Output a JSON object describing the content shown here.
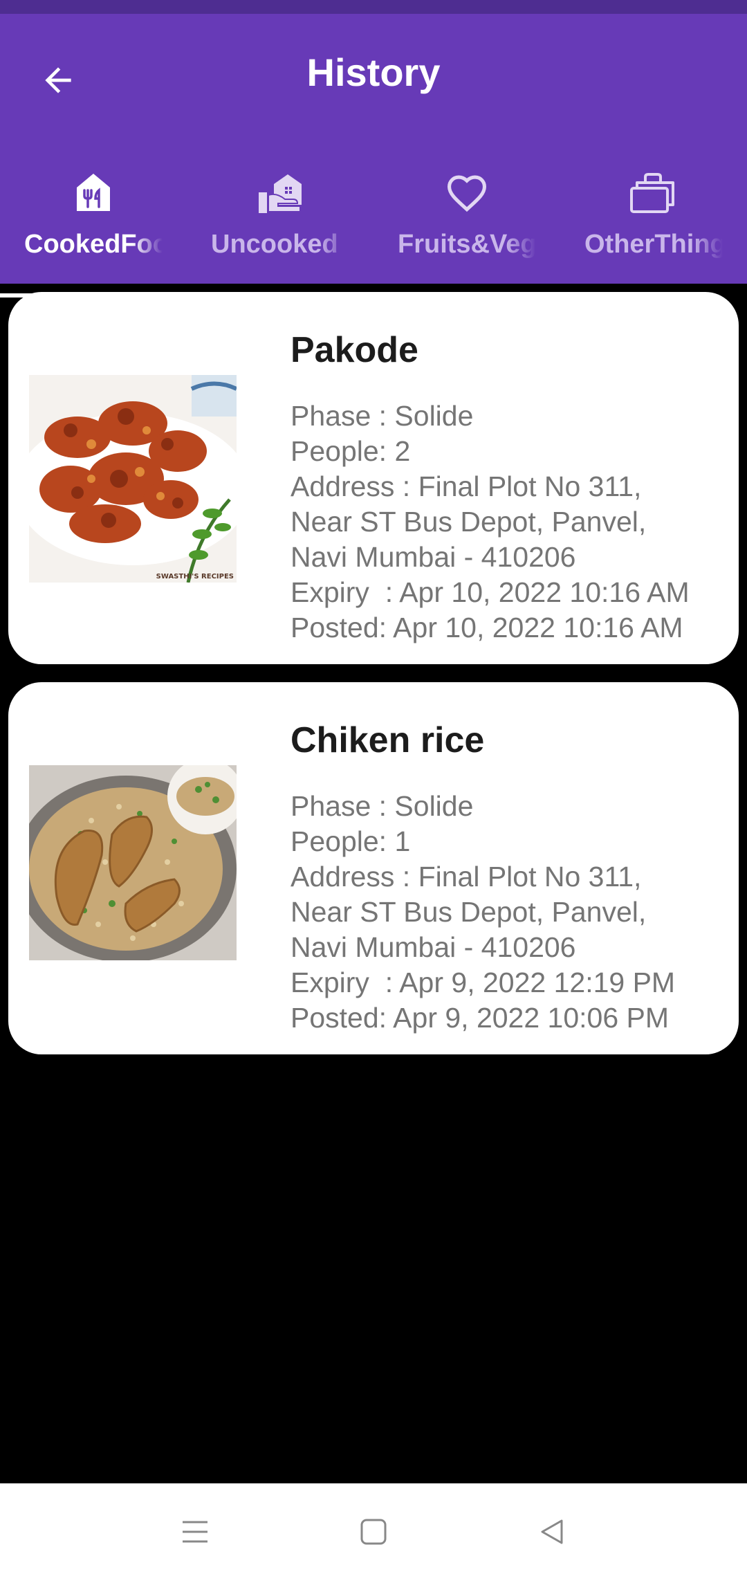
{
  "header": {
    "title": "History"
  },
  "tabs": [
    {
      "label": "CookedFood",
      "icon": "cooked-food-icon",
      "active": true
    },
    {
      "label": "Uncooked",
      "icon": "uncooked-food-icon",
      "active": false
    },
    {
      "label": "Fruits&Vegetables",
      "icon": "heart-icon",
      "active": false
    },
    {
      "label": "OtherThings",
      "icon": "other-things-icon",
      "active": false
    }
  ],
  "items": [
    {
      "name": "Pakode",
      "phase": "Phase : Solide",
      "people": "People: 2",
      "address": "Address : Final Plot No 311,\nNear ST Bus Depot, Panvel,\nNavi Mumbai - 410206",
      "expiry": "Expiry  : Apr 10, 2022 10:16 AM",
      "posted": "Posted: Apr 10, 2022 10:16 AM",
      "image_watermark": "SWASTHI'S RECIPES"
    },
    {
      "name": "Chiken rice",
      "phase": "Phase : Solide",
      "people": "People: 1",
      "address": "Address : Final Plot No 311,\nNear ST Bus Depot, Panvel,\nNavi Mumbai - 410206",
      "expiry": "Expiry  : Apr 9, 2022 12:19 PM",
      "posted": "Posted: Apr 9, 2022 10:06 PM"
    }
  ],
  "colors": {
    "primary": "#673ab7",
    "status_bar": "#4e2d91",
    "inactive_tab": "#c9b6ea",
    "background": "#000000"
  },
  "navbar": {
    "icons": [
      "menu-icon",
      "home-icon",
      "back-triangle-icon"
    ]
  }
}
